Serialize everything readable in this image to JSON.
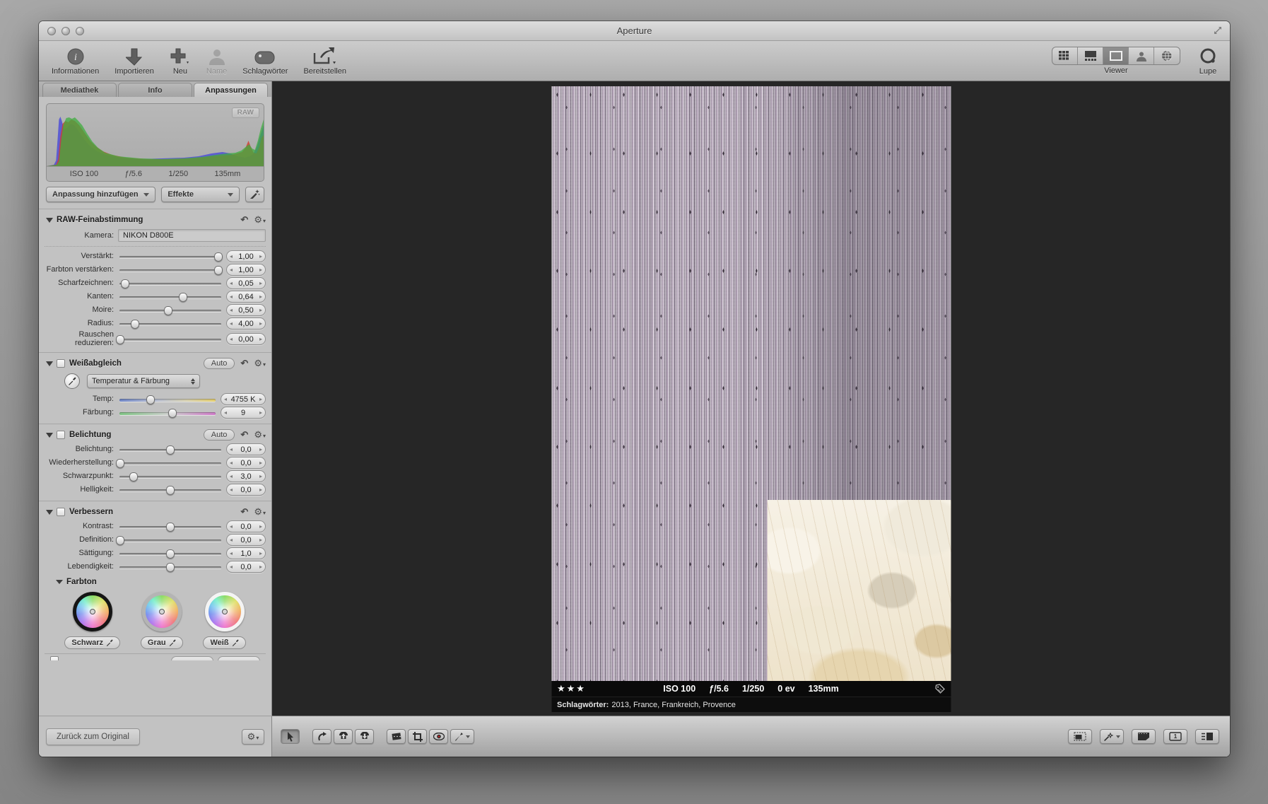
{
  "window": {
    "title": "Aperture"
  },
  "toolbar": {
    "items": [
      {
        "label": "Informationen"
      },
      {
        "label": "Importieren"
      },
      {
        "label": "Neu"
      },
      {
        "label": "Name"
      },
      {
        "label": "Schlagwörter"
      },
      {
        "label": "Bereitstellen"
      }
    ],
    "viewer_label": "Viewer",
    "loupe_label": "Lupe"
  },
  "tabs": {
    "library": "Mediathek",
    "info": "Info",
    "adjustments": "Anpassungen"
  },
  "histogram": {
    "badge": "RAW",
    "meta": [
      "ISO 100",
      "ƒ/5.6",
      "1/250",
      "135mm"
    ]
  },
  "controls": {
    "add_adjustment": "Anpassung hinzufügen",
    "effects": "Effekte"
  },
  "raw": {
    "title": "RAW-Feinabstimmung",
    "camera_label": "Kamera:",
    "camera": "NIKON D800E",
    "rows": [
      {
        "label": "Verstärkt:",
        "value": "1,00",
        "pct": 96
      },
      {
        "label": "Farbton verstärken:",
        "value": "1,00",
        "pct": 96
      },
      {
        "label": "Scharfzeichnen:",
        "value": "0,05",
        "pct": 7,
        "group": "start"
      },
      {
        "label": "Kanten:",
        "value": "0,64",
        "pct": 62
      },
      {
        "label": "Moire:",
        "value": "0,50",
        "pct": 48,
        "group": "start"
      },
      {
        "label": "Radius:",
        "value": "4,00",
        "pct": 16
      },
      {
        "label": "Rauschen reduzieren:",
        "value": "0,00",
        "pct": 2
      }
    ]
  },
  "white_balance": {
    "title": "Weißabgleich",
    "auto": "Auto",
    "mode": "Temperatur & Färbung",
    "rows": [
      {
        "label": "Temp:",
        "value": "4755 K",
        "pct": 33,
        "track": "temp"
      },
      {
        "label": "Färbung:",
        "value": "9",
        "pct": 55,
        "track": "tint"
      }
    ]
  },
  "exposure": {
    "title": "Belichtung",
    "auto": "Auto",
    "rows": [
      {
        "label": "Belichtung:",
        "value": "0,0",
        "pct": 50
      },
      {
        "label": "Wiederherstellung:",
        "value": "0,0",
        "pct": 2
      },
      {
        "label": "Schwarzpunkt:",
        "value": "3,0",
        "pct": 15
      },
      {
        "label": "Helligkeit:",
        "value": "0,0",
        "pct": 50
      }
    ]
  },
  "enhance": {
    "title": "Verbessern",
    "rows": [
      {
        "label": "Kontrast:",
        "value": "0,0",
        "pct": 50
      },
      {
        "label": "Definition:",
        "value": "0,0",
        "pct": 2
      },
      {
        "label": "Sättigung:",
        "value": "1,0",
        "pct": 50
      },
      {
        "label": "Lebendigkeit:",
        "value": "0,0",
        "pct": 50
      }
    ]
  },
  "tint_section": {
    "title": "Farbton",
    "wheels": {
      "black": "Schwarz",
      "gray": "Grau",
      "white": "Weiß"
    }
  },
  "footer": {
    "back": "Zurück zum Original"
  },
  "viewer": {
    "rating": "★★★",
    "meta": [
      "ISO 100",
      "ƒ/5.6",
      "1/250",
      "0 ev",
      "135mm"
    ],
    "keywords_label": "Schlagwörter:",
    "keywords": "2013, France, Frankreich, Provence"
  },
  "bottom_right": {
    "primary_label": "1"
  }
}
